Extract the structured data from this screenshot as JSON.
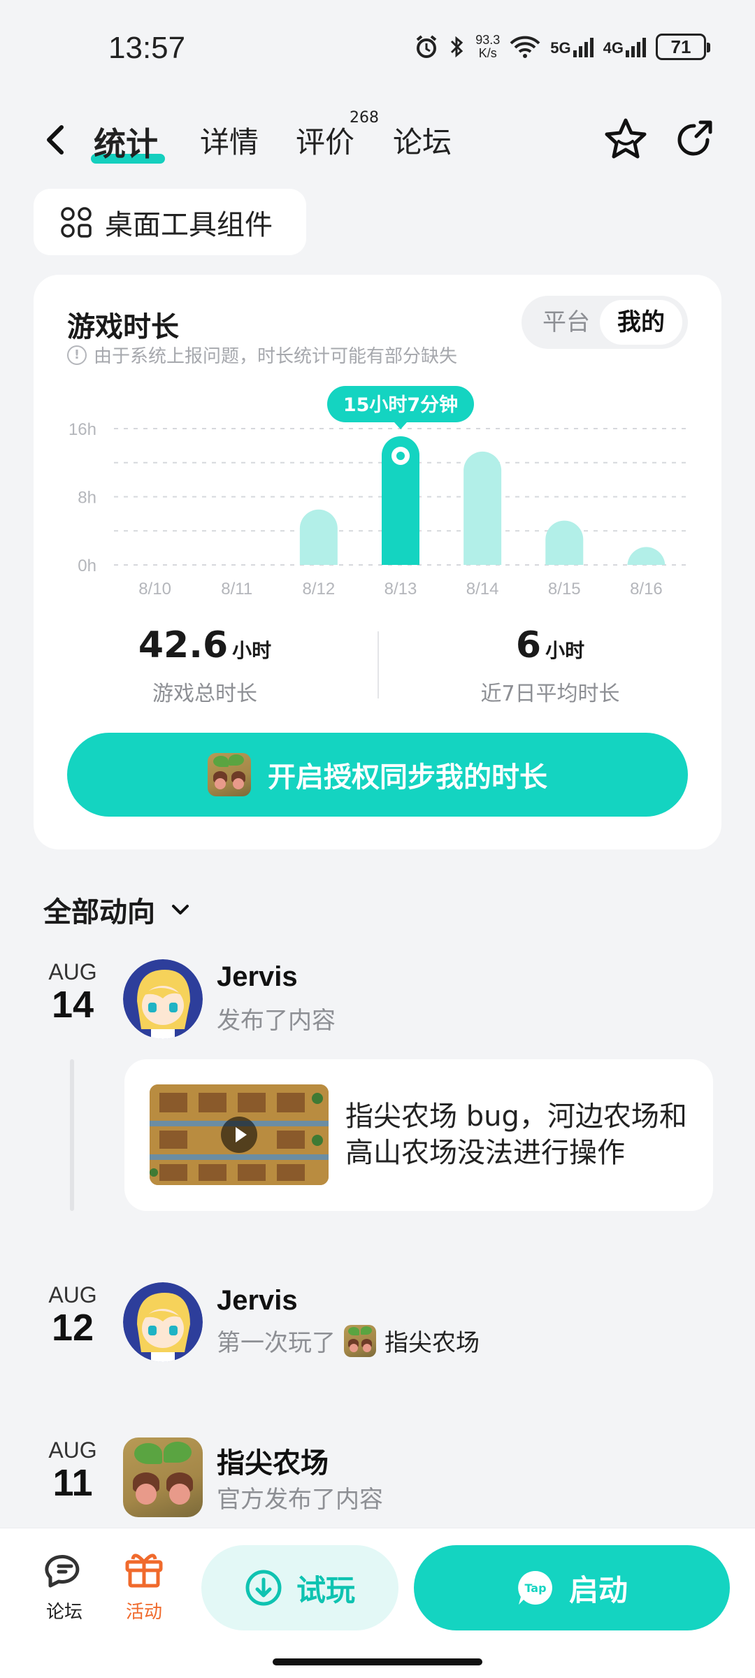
{
  "status_bar": {
    "time": "13:57",
    "net_speed_value": "93.3",
    "net_speed_unit": "K/s",
    "sig1": "5G",
    "sig2": "4G",
    "battery": "71"
  },
  "nav": {
    "tabs": [
      {
        "label": "统计"
      },
      {
        "label": "详情"
      },
      {
        "label": "评价"
      },
      {
        "label": "论坛"
      }
    ],
    "review_count": "268"
  },
  "widget_chip": {
    "label": "桌面工具组件"
  },
  "stats_card": {
    "title": "游戏时长",
    "note": "由于系统上报问题，时长统计可能有部分缺失",
    "toggle": {
      "platform": "平台",
      "mine": "我的"
    },
    "total": {
      "value": "42.6",
      "unit": "小时",
      "caption": "游戏总时长"
    },
    "average": {
      "value": "6",
      "unit": "小时",
      "caption": "近7日平均时长"
    },
    "sync_button": "开启授权同步我的时长"
  },
  "chart_data": {
    "type": "bar",
    "categories": [
      "8/10",
      "8/11",
      "8/12",
      "8/13",
      "8/14",
      "8/15",
      "8/16"
    ],
    "values": [
      0,
      0,
      6.5,
      15.1,
      13.3,
      5.2,
      2.1
    ],
    "ylim": [
      0,
      16
    ],
    "yticks": [
      "16h",
      "8h",
      "0h"
    ],
    "yticks_values": [
      16,
      8,
      0
    ],
    "highlight_index": 3,
    "highlight_label": "15小时7分钟",
    "colors": {
      "highlight": "#14d4c1",
      "normal": "#b2efe8",
      "grid": "#d6d8dc",
      "tick": "#b4b6bb"
    }
  },
  "feed": {
    "header": "全部动向",
    "items": [
      {
        "month": "AUG",
        "day": "14",
        "name": "Jervis",
        "sub": "发布了内容",
        "post": "指尖农场 bug，河边农场和高山农场没法进行操作"
      },
      {
        "month": "AUG",
        "day": "12",
        "name": "Jervis",
        "sub": "第一次玩了",
        "game": "指尖农场"
      },
      {
        "month": "AUG",
        "day": "11",
        "name": "指尖农场",
        "sub": "官方发布了内容"
      }
    ]
  },
  "bottom_bar": {
    "forum": "论坛",
    "events": "活动",
    "try": "试玩",
    "launch": "启动",
    "launch_badge": "Tap"
  },
  "colors": {
    "accent": "#14d4c1",
    "events": "#f06a2c"
  }
}
